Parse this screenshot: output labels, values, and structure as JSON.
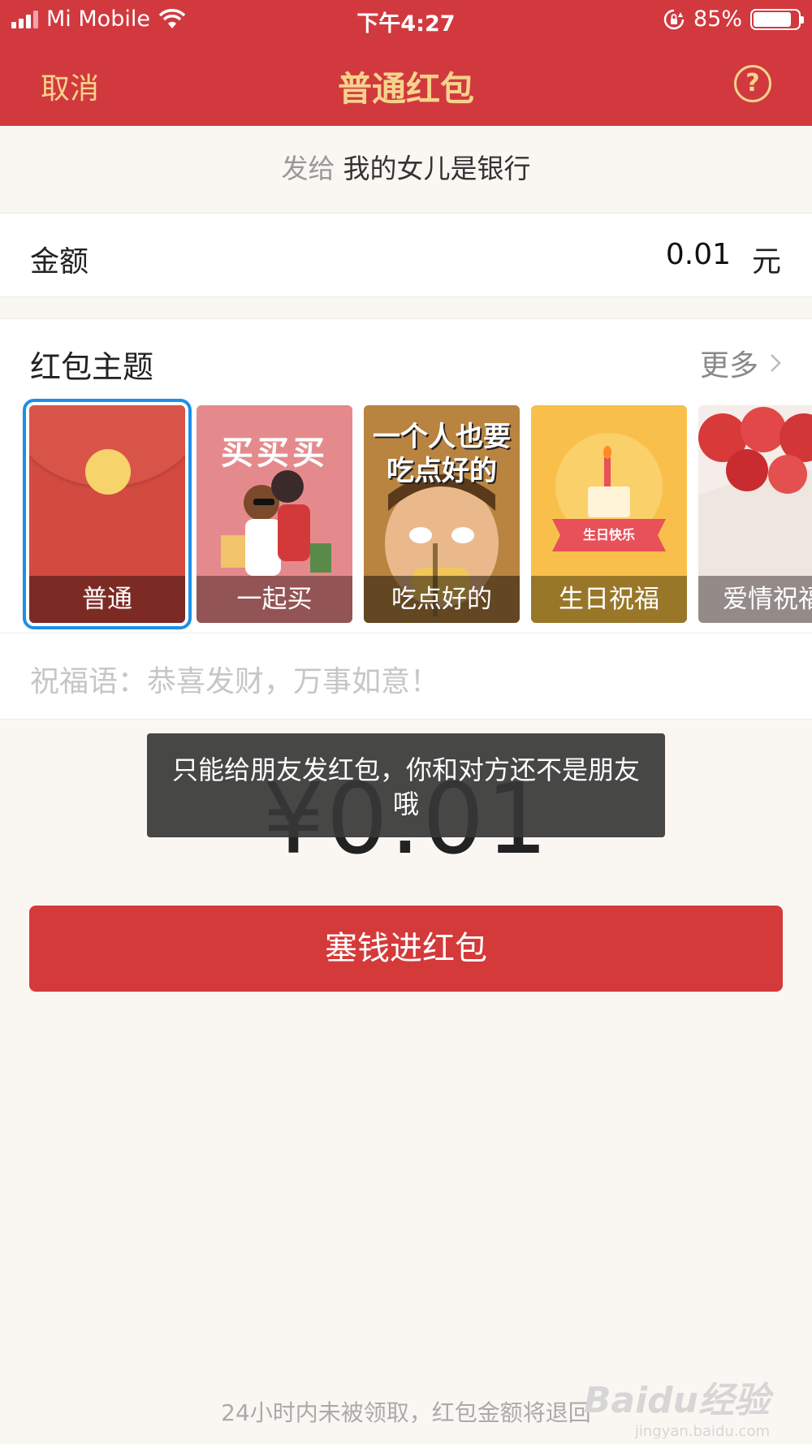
{
  "status_bar": {
    "carrier": "Mi Mobile",
    "time": "下午4:27",
    "battery": "85%"
  },
  "nav": {
    "cancel": "取消",
    "title": "普通红包",
    "help": "?"
  },
  "send_to": {
    "label": "发给",
    "name": "我的女儿是银行"
  },
  "amount": {
    "label": "金额",
    "value": "0.01",
    "unit": "元"
  },
  "theme": {
    "label": "红包主题",
    "more": "更多",
    "cards": [
      {
        "label": "普通",
        "selected": true
      },
      {
        "label": "一起买",
        "art_text": "买买买"
      },
      {
        "label": "吃点好的",
        "art_text": "一个人也要吃点好的"
      },
      {
        "label": "生日祝福",
        "art_text": "生日快乐"
      },
      {
        "label": "爱情祝福"
      }
    ]
  },
  "blessing": {
    "placeholder": "祝福语：恭喜发财，万事如意！"
  },
  "big_amount": "¥0.01",
  "toast": "只能给朋友发红包，你和对方还不是朋友哦",
  "submit_button": "塞钱进红包",
  "footer_note": "24小时内未被领取，红包金额将退回",
  "watermark": {
    "logo": "Baidu经验",
    "url": "jingyan.baidu.com"
  },
  "colors": {
    "header_red": "#d1393e",
    "title_gold": "#f6d38c",
    "button_red": "#d43a3a",
    "selection_blue": "#1c8fe8"
  }
}
